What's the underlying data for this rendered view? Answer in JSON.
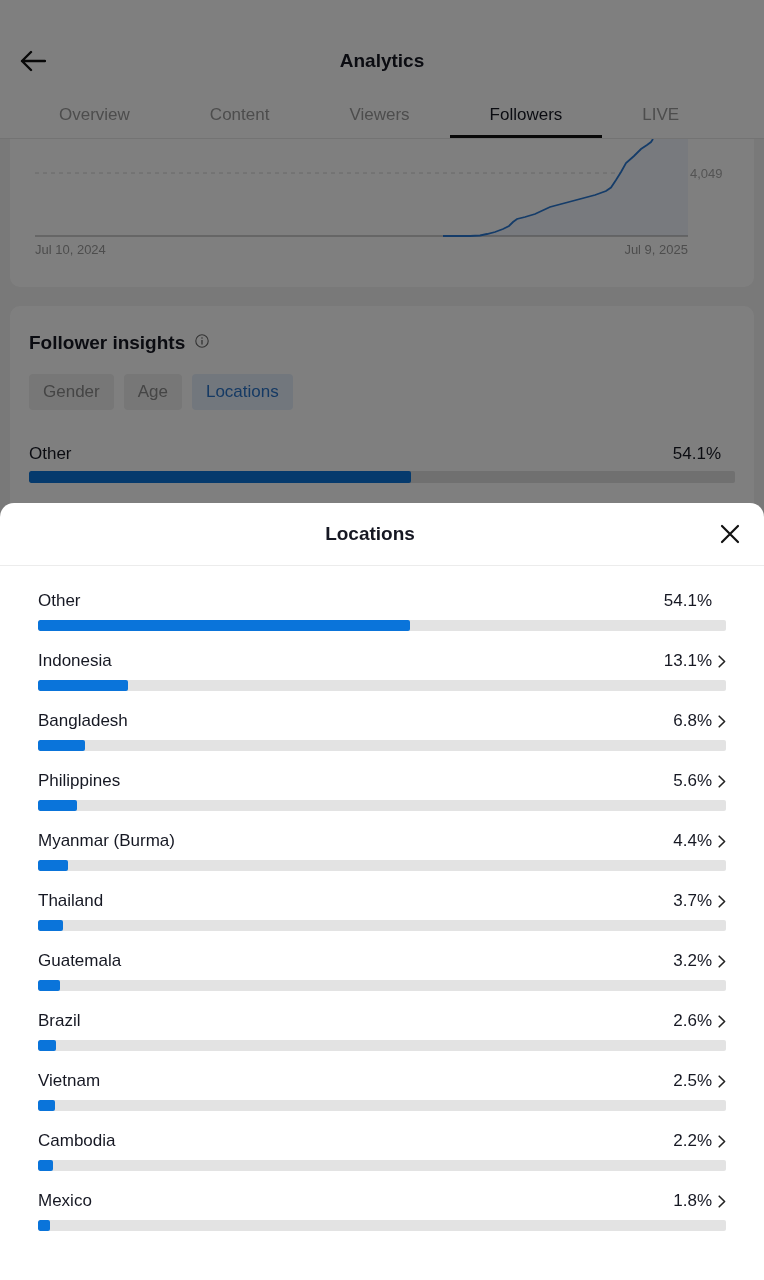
{
  "header": {
    "title": "Analytics"
  },
  "tabs": [
    {
      "label": "Overview",
      "selected": false
    },
    {
      "label": "Content",
      "selected": false
    },
    {
      "label": "Viewers",
      "selected": false
    },
    {
      "label": "Followers",
      "selected": true
    },
    {
      "label": "LIVE",
      "selected": false
    }
  ],
  "growth_chart": {
    "y_tick": "4,049",
    "x_start": "Jul 10, 2024",
    "x_end": "Jul 9, 2025"
  },
  "follower_insights": {
    "title": "Follower insights",
    "filters": [
      {
        "label": "Gender",
        "selected": false
      },
      {
        "label": "Age",
        "selected": false
      },
      {
        "label": "Locations",
        "selected": true
      }
    ],
    "top_location": {
      "name": "Other",
      "value": "54.1%",
      "level": 0.541
    }
  },
  "locations_sheet": {
    "title": "Locations",
    "rows": [
      {
        "name": "Other",
        "value": "54.1%",
        "level": 0.541,
        "navigable": false
      },
      {
        "name": "Indonesia",
        "value": "13.1%",
        "level": 0.131,
        "navigable": true
      },
      {
        "name": "Bangladesh",
        "value": "6.8%",
        "level": 0.068,
        "navigable": true
      },
      {
        "name": "Philippines",
        "value": "5.6%",
        "level": 0.056,
        "navigable": true
      },
      {
        "name": "Myanmar (Burma)",
        "value": "4.4%",
        "level": 0.044,
        "navigable": true
      },
      {
        "name": "Thailand",
        "value": "3.7%",
        "level": 0.037,
        "navigable": true
      },
      {
        "name": "Guatemala",
        "value": "3.2%",
        "level": 0.032,
        "navigable": true
      },
      {
        "name": "Brazil",
        "value": "2.6%",
        "level": 0.026,
        "navigable": true
      },
      {
        "name": "Vietnam",
        "value": "2.5%",
        "level": 0.025,
        "navigable": true
      },
      {
        "name": "Cambodia",
        "value": "2.2%",
        "level": 0.022,
        "navigable": true
      },
      {
        "name": "Mexico",
        "value": "1.8%",
        "level": 0.018,
        "navigable": true
      }
    ]
  }
}
